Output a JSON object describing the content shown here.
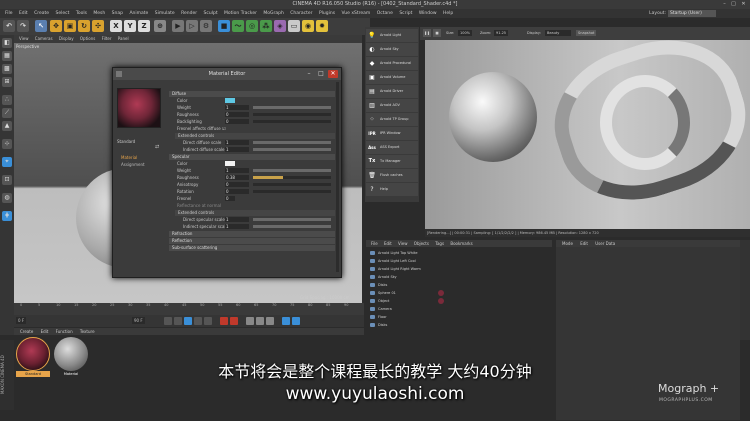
{
  "window": {
    "title": "CINEMA 4D R16.050 Studio (R16) - [0402_Standard_Shader.c4d *]"
  },
  "menu": [
    "File",
    "Edit",
    "Create",
    "Select",
    "Tools",
    "Mesh",
    "Snap",
    "Animate",
    "Simulate",
    "Render",
    "Sculpt",
    "Motion Tracker",
    "MoGraph",
    "Character",
    "Plugins",
    "Vue xStream",
    "Octane",
    "Script",
    "Window",
    "Help"
  ],
  "layout": {
    "label": "Layout:",
    "value": "Startup (User)"
  },
  "toolbar": {
    "x": "X",
    "y": "Y",
    "z": "Z"
  },
  "viewport": {
    "menu": [
      "View",
      "Cameras",
      "Display",
      "Options",
      "Filter",
      "Panel"
    ],
    "label": "Perspective",
    "grid_spacing": "Grid Spacing : 10000 cm"
  },
  "material_editor": {
    "title": "Material Editor",
    "material_name": "Standard",
    "nav": [
      "Material",
      "Assignment"
    ],
    "sections": {
      "diffuse": "Diffuse",
      "specular": "Specular",
      "refraction": "Refraction",
      "reflection": "Reflection",
      "sss": "Sub-surface scattering"
    },
    "diffuse_rows": [
      {
        "label": "Color",
        "value": ""
      },
      {
        "label": "Weight",
        "value": "1",
        "fill": 1.0
      },
      {
        "label": "Roughness",
        "value": "0",
        "fill": 0
      },
      {
        "label": "Backlighting",
        "value": "0",
        "fill": 0
      }
    ],
    "fresnel_diffuse": "Fresnel affects diffuse",
    "extended_controls": "Extended controls",
    "direct_diffuse": {
      "label": "Direct diffuse scale",
      "value": "1"
    },
    "indirect_diffuse": {
      "label": "Indirect diffuse scale",
      "value": "1"
    },
    "specular_rows": [
      {
        "label": "Color",
        "value": ""
      },
      {
        "label": "Weight",
        "value": "1",
        "fill": 1.0
      },
      {
        "label": "Roughness",
        "value": "0.38",
        "fill": 0.38
      },
      {
        "label": "Anisotropy",
        "value": "0",
        "fill": 0
      },
      {
        "label": "Rotation",
        "value": "0",
        "fill": 0
      }
    ],
    "fresnel_row": {
      "label": "Fresnel",
      "value": "0"
    },
    "reflectance": "Reflectance at normal",
    "direct_specular": {
      "label": "Direct specular scale",
      "value": "1"
    },
    "indirect_specular": {
      "label": "Indirect specular scale",
      "value": "1"
    }
  },
  "arnold_toolbar": [
    {
      "icon": "bulb-icon",
      "label": "Arnold Light"
    },
    {
      "icon": "sky-icon",
      "label": "Arnold Sky"
    },
    {
      "icon": "procedural-icon",
      "label": "Arnold Procedural"
    },
    {
      "icon": "volume-icon",
      "label": "Arnold Volume"
    },
    {
      "icon": "driver-icon",
      "label": "Arnold Driver"
    },
    {
      "icon": "aov-icon",
      "label": "Arnold AOV"
    },
    {
      "icon": "tp-icon",
      "label": "Arnold TP Group"
    },
    {
      "icon": "ipr-icon",
      "label": "IPR Window"
    },
    {
      "icon": "ass-icon",
      "label": "ASS Export"
    },
    {
      "icon": "tx-icon",
      "label": "Tx Manager"
    },
    {
      "icon": "trash-icon",
      "label": "Flush caches"
    },
    {
      "icon": "help-icon",
      "label": "Help"
    }
  ],
  "render_view": {
    "zoom_label": "Size:",
    "zoom": "100%",
    "zoom2_label": "Zoom:",
    "zoom2": "91.25",
    "display_label": "Display:",
    "display": "Beauty",
    "snapshot": "Snapshot",
    "status": "[Rendering...] | 00:00:31 | Sampling: [ 1/1/2/2/2/2 ] | Memory: 986.45 MB | Resolution: 1280 x 720"
  },
  "object_manager": {
    "menu": [
      "File",
      "Edit",
      "View",
      "Objects",
      "Tags",
      "Bookmarks"
    ],
    "objects": [
      "Arnold Light Top White",
      "Arnold Light Left Cool",
      "Arnold Light Right Warm",
      "Arnold Sky",
      "Disks",
      "Sphere 01",
      "Object",
      "Camera",
      "Floor",
      "Disks"
    ]
  },
  "attributes": {
    "menu": [
      "Mode",
      "Edit",
      "User Data"
    ]
  },
  "timeline": {
    "ticks": [
      "0",
      "5",
      "10",
      "15",
      "20",
      "25",
      "30",
      "35",
      "40",
      "45",
      "50",
      "55",
      "60",
      "65",
      "70",
      "75",
      "80",
      "85",
      "90"
    ],
    "frame": "0 F",
    "end": "90 F"
  },
  "material_manager": {
    "menu": [
      "Create",
      "Edit",
      "Function",
      "Texture"
    ],
    "materials": [
      {
        "name": "Standard"
      },
      {
        "name": "Material"
      }
    ]
  },
  "maxon_label": "MAXON CINEMA 4D",
  "subtitle": {
    "line1": "本节将会是整个课程最长的教学 大约40分钟",
    "line2": "www.yuyulaoshi.com"
  },
  "watermark": {
    "brand": "Mograph",
    "plus": "+",
    "domain": "MOGRAPHPLUS.COM"
  },
  "colors": {
    "accent": "#3a8fd8",
    "diffuse_swatch": "#5ec8e4"
  }
}
